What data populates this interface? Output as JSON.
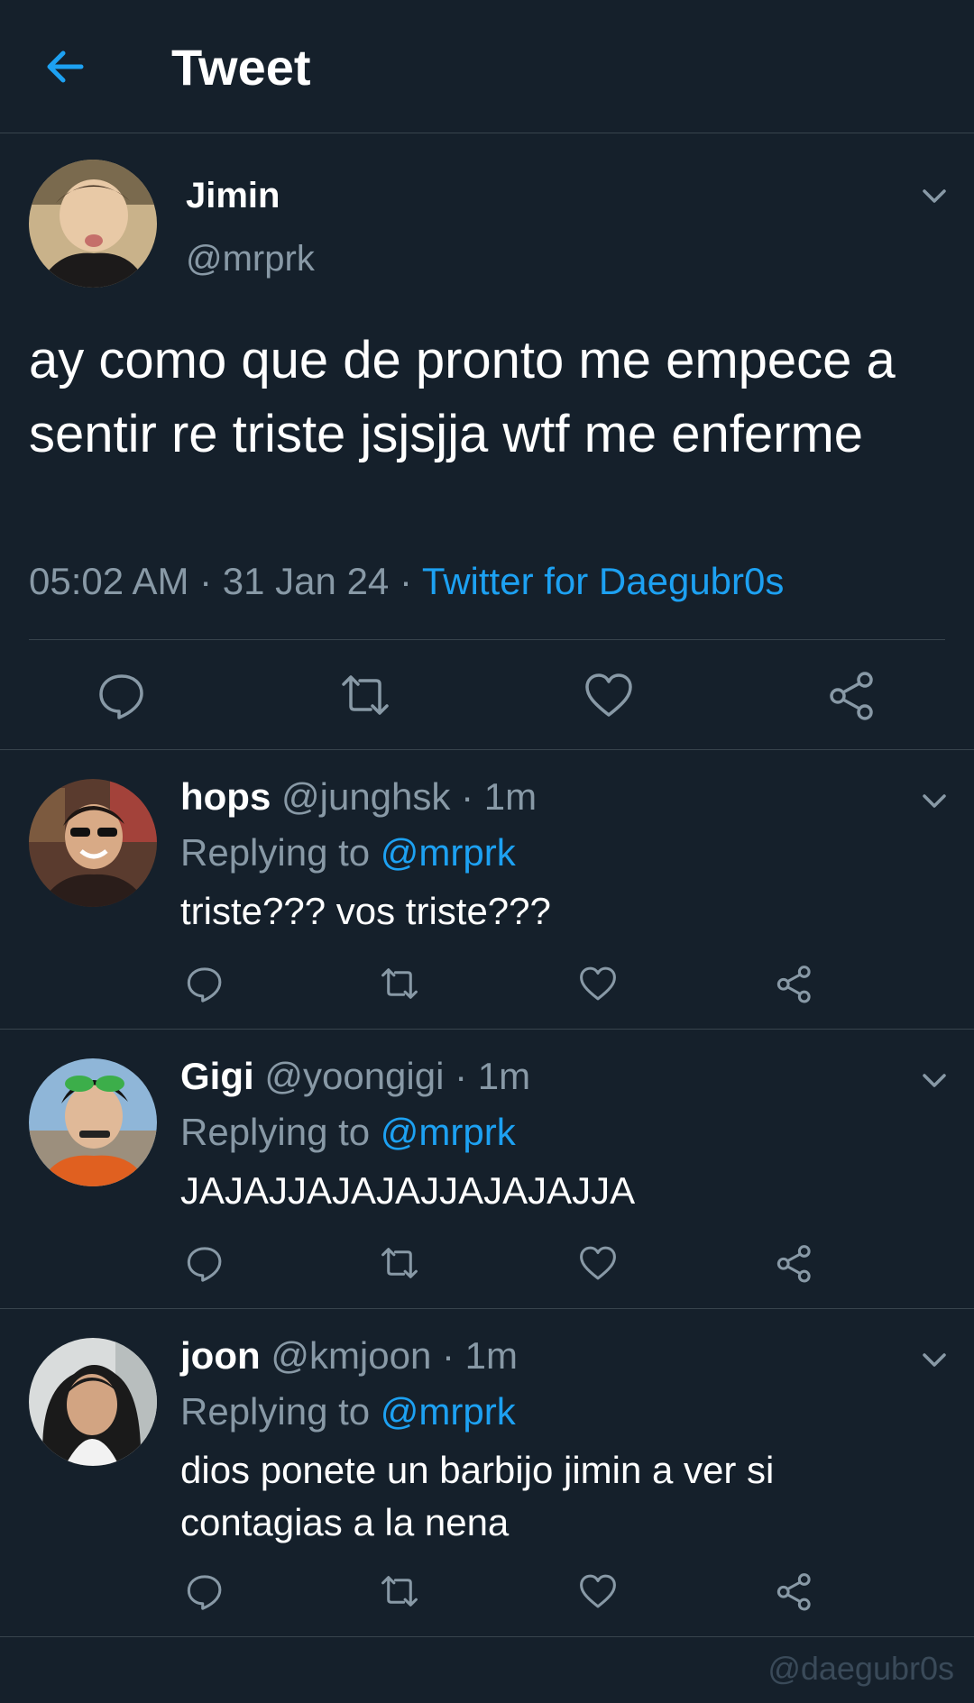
{
  "header": {
    "title": "Tweet",
    "back_icon": "arrow-left-icon"
  },
  "colors": {
    "background": "#15202b",
    "accent": "#1da1f2",
    "muted": "#8899a6",
    "divider": "#38444d"
  },
  "tweet": {
    "name": "Jimin",
    "handle": "@mrprk",
    "text": "ay como que de pronto me empece a sentir re triste jsjsjja wtf me enferme",
    "time": "05:02 AM",
    "date": "31 Jan 24",
    "source": "Twitter for Daegubr0s",
    "sep": " · "
  },
  "replies": [
    {
      "name": "hops",
      "handle": "@junghsk",
      "age": "1m",
      "replying_label": "Replying to",
      "replying_to": "@mrprk",
      "text": "triste??? vos triste???"
    },
    {
      "name": "Gigi",
      "handle": "@yoongigi",
      "age": "1m",
      "replying_label": "Replying to",
      "replying_to": "@mrprk",
      "text": "JAJAJJAJAJAJJAJAJAJJA"
    },
    {
      "name": "joon",
      "handle": "@kmjoon",
      "age": "1m",
      "replying_label": "Replying to",
      "replying_to": "@mrprk",
      "text": "dios ponete un barbijo jimin a ver si contagias a la nena"
    }
  ],
  "watermark": "@daegubr0s"
}
